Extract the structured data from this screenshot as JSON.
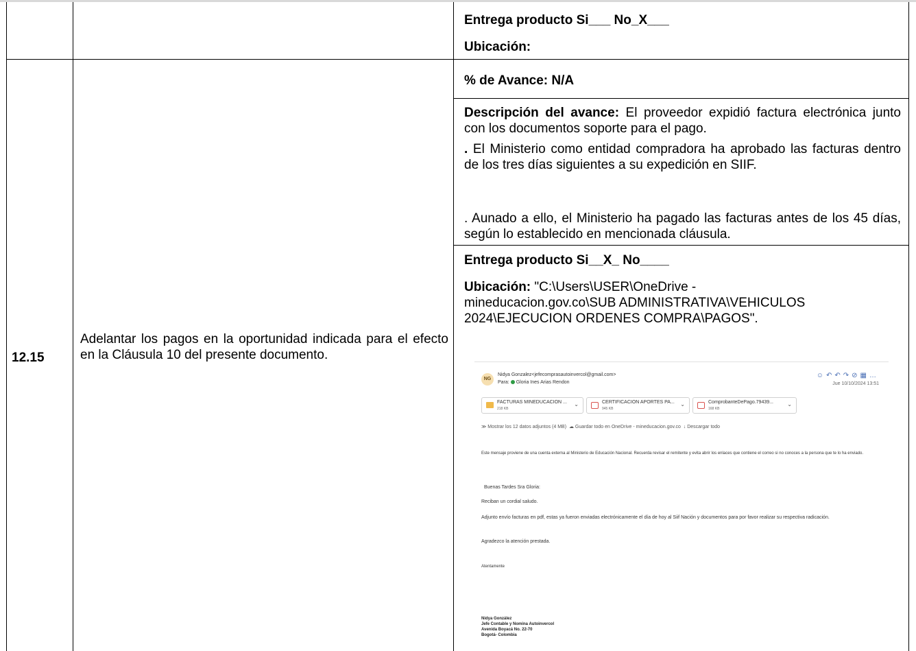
{
  "row_top": {
    "entrega": "Entrega producto Si___ No_X___",
    "ubicacion_label": "Ubicación:"
  },
  "row_main": {
    "number": "12.15",
    "obligation": "Adelantar los pagos en la oportunidad indicada para el efecto en la Cláusula 10 del presente documento.",
    "avance": "% de Avance: N/A",
    "descripcion_label": "Descripción del avance:",
    "descripcion_p1": " El proveedor expidió factura electrónica junto con los documentos soporte para el pago.",
    "descripcion_p2_dot": ".",
    "descripcion_p2": " El Ministerio como entidad compradora ha aprobado las facturas dentro de los tres días siguientes a su expedición en SIIF.",
    "descripcion_p3": ". Aunado a ello, el Ministerio ha pagado las facturas antes de los 45 días, según lo establecido en mencionada cláusula.",
    "entrega": "Entrega producto Si__X_ No____",
    "ubicacion_label": "Ubicación:",
    "ubicacion_line1": " \"C:\\Users\\USER\\OneDrive -",
    "ubicacion_line2": "mineducacion.gov.co\\SUB ADMINISTRATIVA\\VEHICULOS",
    "ubicacion_line3": "2024\\EJECUCION ORDENES COMPRA\\PAGOS\"."
  },
  "email": {
    "avatar": "NG",
    "from": "Nidya Gonzalez<jefecomprasautoinvercol@gmail.com>",
    "to_label": "Para:",
    "to": "Gloria Ines Arias Rendon",
    "date": "Jue 10/10/2024 13:51",
    "attachments": [
      {
        "name": "FACTURAS MINEDUCACION ...",
        "size": "218 KB",
        "icon": "folder-icon"
      },
      {
        "name": "CERTIFICACION APORTES PA...",
        "size": "945 KB",
        "icon": "pdf-icon"
      },
      {
        "name": "ComprobanteDePago.79439...",
        "size": "168 KB",
        "icon": "pdf-icon"
      }
    ],
    "actions": "Mostrar los 12 datos adjuntos (4 MB)",
    "save_onedrive": "Guardar todo en OneDrive - mineducacion.gov.co",
    "download_all": "Descargar todo",
    "warning": "Este mensaje proviene de una cuenta externa al Ministerio de Educación Nacional. Recuerda revisar el remitente y evita abrir los enlaces que contiene el correo si no conoces a la persona que te lo ha enviado.",
    "greeting": "Buenas Tardes Sra Gloria:",
    "line1": "Reciban un cordial saludo.",
    "line2": "Adjunto envío facturas en pdf, estas ya fueron enviadas electrónicamente el día de hoy al Siif Nación y documentos para por favor realizar su respectiva radicación.",
    "line3": "Agradezco la atención prestada.",
    "closing": "Atentamente",
    "sig_name": "Nidya González",
    "sig_title": "Jefe Contable y Nomina Autoinvercol",
    "sig_address": "Avenida Boyacá No. 22-70",
    "sig_city": "Bogotá- Colombia"
  }
}
